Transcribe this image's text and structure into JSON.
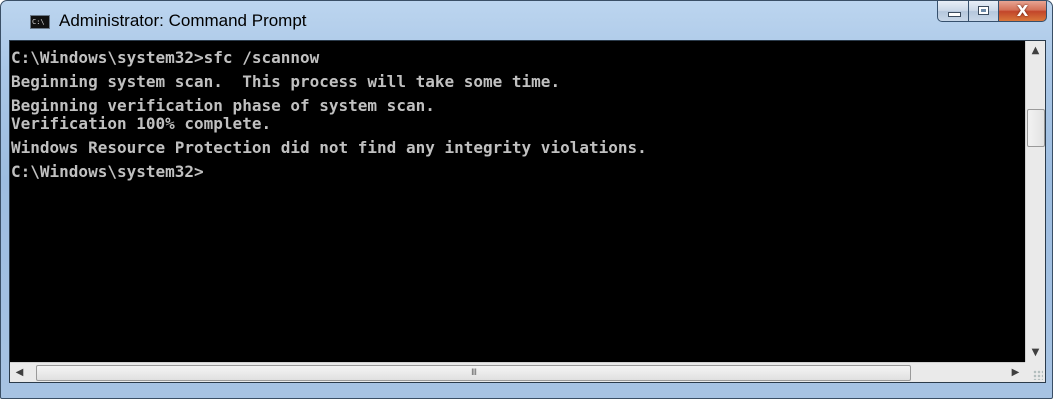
{
  "window": {
    "title": "Administrator: Command Prompt",
    "icon_label": "C:\\",
    "icon": "cmd-icon"
  },
  "caption_buttons": {
    "minimize": "minimize-icon",
    "maximize": "maximize-icon",
    "close_glyph": "X"
  },
  "console": {
    "lines": [
      "C:\\Windows\\system32>sfc /scannow",
      "Beginning system scan.  This process will take some time.",
      "Beginning verification phase of system scan.",
      "Verification 100% complete.",
      "Windows Resource Protection did not find any integrity violations.",
      "C:\\Windows\\system32>"
    ]
  },
  "scrollbars": {
    "up_arrow": "▲",
    "down_arrow": "▼",
    "left_arrow": "◀",
    "right_arrow": "▶",
    "h_thumb_grip": "III"
  },
  "colors": {
    "console_bg": "#000000",
    "console_fg": "#c0c0c0",
    "close_button": "#c2452a"
  }
}
